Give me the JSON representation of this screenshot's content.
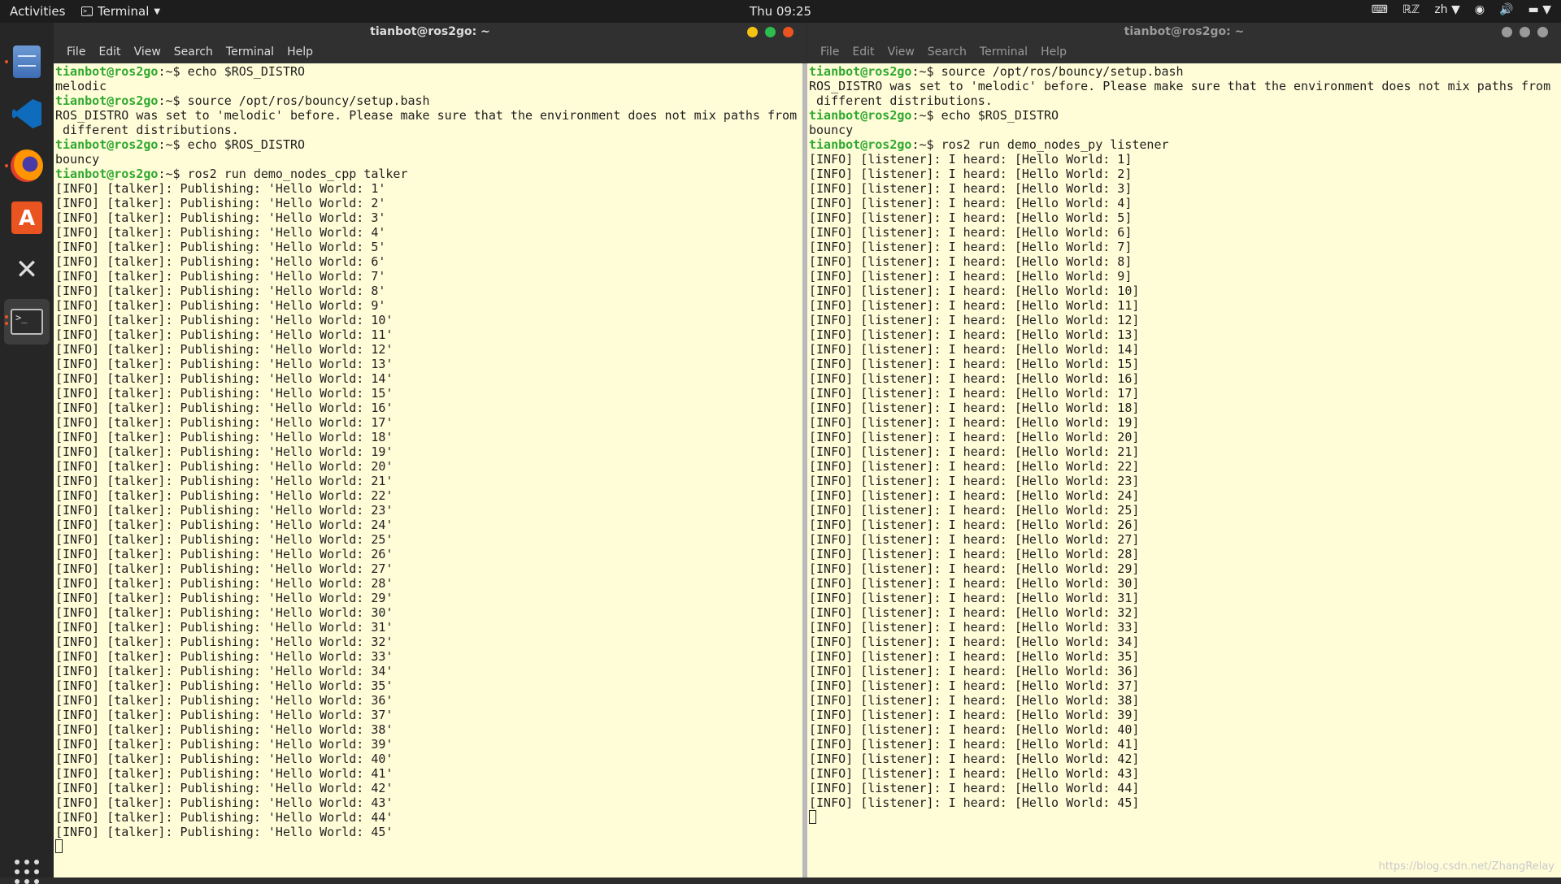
{
  "topbar": {
    "activities": "Activities",
    "app_name": "Terminal",
    "clock": "Thu 09:25",
    "tray": {
      "keyboard_layout_icon": "keyboard-icon",
      "input_method": "ℝℤ",
      "language": "zh",
      "wifi_icon": "wifi-icon",
      "volume_icon": "volume-icon",
      "battery_icon": "battery-icon"
    }
  },
  "dock": {
    "items": [
      {
        "name": "Files",
        "icon": "files-icon"
      },
      {
        "name": "Visual Studio Code",
        "icon": "vscode-icon"
      },
      {
        "name": "Firefox",
        "icon": "firefox-icon"
      },
      {
        "name": "Ubuntu Software",
        "icon": "software-icon"
      },
      {
        "name": "Tools",
        "icon": "tools-icon"
      },
      {
        "name": "Terminal",
        "icon": "terminal-icon"
      }
    ],
    "show_apps_icon": "apps-grid-icon"
  },
  "left_window": {
    "title": "tianbot@ros2go: ~",
    "menu": [
      "File",
      "Edit",
      "View",
      "Search",
      "Terminal",
      "Help"
    ],
    "prompt": "tianbot@ros2go",
    "lines": [
      {
        "type": "cmd",
        "prompt": "tianbot@ros2go",
        "suffix": ":~$ ",
        "text": "echo $ROS_DISTRO"
      },
      {
        "type": "out",
        "text": "melodic"
      },
      {
        "type": "cmd",
        "prompt": "tianbot@ros2go",
        "suffix": ":~$ ",
        "text": "source /opt/ros/bouncy/setup.bash"
      },
      {
        "type": "out",
        "text": "ROS_DISTRO was set to 'melodic' before. Please make sure that the environment does not mix paths from"
      },
      {
        "type": "out",
        "text": " different distributions."
      },
      {
        "type": "cmd",
        "prompt": "tianbot@ros2go",
        "suffix": ":~$ ",
        "text": "echo $ROS_DISTRO"
      },
      {
        "type": "out",
        "text": "bouncy"
      },
      {
        "type": "cmd",
        "prompt": "tianbot@ros2go",
        "suffix": ":~$ ",
        "text": "ros2 run demo_nodes_cpp talker"
      },
      {
        "type": "out",
        "text": "[INFO] [talker]: Publishing: 'Hello World: 1'"
      },
      {
        "type": "out",
        "text": "[INFO] [talker]: Publishing: 'Hello World: 2'"
      },
      {
        "type": "out",
        "text": "[INFO] [talker]: Publishing: 'Hello World: 3'"
      },
      {
        "type": "out",
        "text": "[INFO] [talker]: Publishing: 'Hello World: 4'"
      },
      {
        "type": "out",
        "text": "[INFO] [talker]: Publishing: 'Hello World: 5'"
      },
      {
        "type": "out",
        "text": "[INFO] [talker]: Publishing: 'Hello World: 6'"
      },
      {
        "type": "out",
        "text": "[INFO] [talker]: Publishing: 'Hello World: 7'"
      },
      {
        "type": "out",
        "text": "[INFO] [talker]: Publishing: 'Hello World: 8'"
      },
      {
        "type": "out",
        "text": "[INFO] [talker]: Publishing: 'Hello World: 9'"
      },
      {
        "type": "out",
        "text": "[INFO] [talker]: Publishing: 'Hello World: 10'"
      },
      {
        "type": "out",
        "text": "[INFO] [talker]: Publishing: 'Hello World: 11'"
      },
      {
        "type": "out",
        "text": "[INFO] [talker]: Publishing: 'Hello World: 12'"
      },
      {
        "type": "out",
        "text": "[INFO] [talker]: Publishing: 'Hello World: 13'"
      },
      {
        "type": "out",
        "text": "[INFO] [talker]: Publishing: 'Hello World: 14'"
      },
      {
        "type": "out",
        "text": "[INFO] [talker]: Publishing: 'Hello World: 15'"
      },
      {
        "type": "out",
        "text": "[INFO] [talker]: Publishing: 'Hello World: 16'"
      },
      {
        "type": "out",
        "text": "[INFO] [talker]: Publishing: 'Hello World: 17'"
      },
      {
        "type": "out",
        "text": "[INFO] [talker]: Publishing: 'Hello World: 18'"
      },
      {
        "type": "out",
        "text": "[INFO] [talker]: Publishing: 'Hello World: 19'"
      },
      {
        "type": "out",
        "text": "[INFO] [talker]: Publishing: 'Hello World: 20'"
      },
      {
        "type": "out",
        "text": "[INFO] [talker]: Publishing: 'Hello World: 21'"
      },
      {
        "type": "out",
        "text": "[INFO] [talker]: Publishing: 'Hello World: 22'"
      },
      {
        "type": "out",
        "text": "[INFO] [talker]: Publishing: 'Hello World: 23'"
      },
      {
        "type": "out",
        "text": "[INFO] [talker]: Publishing: 'Hello World: 24'"
      },
      {
        "type": "out",
        "text": "[INFO] [talker]: Publishing: 'Hello World: 25'"
      },
      {
        "type": "out",
        "text": "[INFO] [talker]: Publishing: 'Hello World: 26'"
      },
      {
        "type": "out",
        "text": "[INFO] [talker]: Publishing: 'Hello World: 27'"
      },
      {
        "type": "out",
        "text": "[INFO] [talker]: Publishing: 'Hello World: 28'"
      },
      {
        "type": "out",
        "text": "[INFO] [talker]: Publishing: 'Hello World: 29'"
      },
      {
        "type": "out",
        "text": "[INFO] [talker]: Publishing: 'Hello World: 30'"
      },
      {
        "type": "out",
        "text": "[INFO] [talker]: Publishing: 'Hello World: 31'"
      },
      {
        "type": "out",
        "text": "[INFO] [talker]: Publishing: 'Hello World: 32'"
      },
      {
        "type": "out",
        "text": "[INFO] [talker]: Publishing: 'Hello World: 33'"
      },
      {
        "type": "out",
        "text": "[INFO] [talker]: Publishing: 'Hello World: 34'"
      },
      {
        "type": "out",
        "text": "[INFO] [talker]: Publishing: 'Hello World: 35'"
      },
      {
        "type": "out",
        "text": "[INFO] [talker]: Publishing: 'Hello World: 36'"
      },
      {
        "type": "out",
        "text": "[INFO] [talker]: Publishing: 'Hello World: 37'"
      },
      {
        "type": "out",
        "text": "[INFO] [talker]: Publishing: 'Hello World: 38'"
      },
      {
        "type": "out",
        "text": "[INFO] [talker]: Publishing: 'Hello World: 39'"
      },
      {
        "type": "out",
        "text": "[INFO] [talker]: Publishing: 'Hello World: 40'"
      },
      {
        "type": "out",
        "text": "[INFO] [talker]: Publishing: 'Hello World: 41'"
      },
      {
        "type": "out",
        "text": "[INFO] [talker]: Publishing: 'Hello World: 42'"
      },
      {
        "type": "out",
        "text": "[INFO] [talker]: Publishing: 'Hello World: 43'"
      },
      {
        "type": "out",
        "text": "[INFO] [talker]: Publishing: 'Hello World: 44'"
      },
      {
        "type": "out",
        "text": "[INFO] [talker]: Publishing: 'Hello World: 45'"
      },
      {
        "type": "cursor"
      }
    ]
  },
  "right_window": {
    "title": "tianbot@ros2go: ~",
    "menu": [
      "File",
      "Edit",
      "View",
      "Search",
      "Terminal",
      "Help"
    ],
    "lines": [
      {
        "type": "cmd",
        "prompt": "tianbot@ros2go",
        "suffix": ":~$ ",
        "text": "source /opt/ros/bouncy/setup.bash"
      },
      {
        "type": "out",
        "text": "ROS_DISTRO was set to 'melodic' before. Please make sure that the environment does not mix paths from"
      },
      {
        "type": "out",
        "text": " different distributions."
      },
      {
        "type": "cmd",
        "prompt": "tianbot@ros2go",
        "suffix": ":~$ ",
        "text": "echo $ROS_DISTRO"
      },
      {
        "type": "out",
        "text": "bouncy"
      },
      {
        "type": "cmd",
        "prompt": "tianbot@ros2go",
        "suffix": ":~$ ",
        "text": "ros2 run demo_nodes_py listener"
      },
      {
        "type": "out",
        "text": "[INFO] [listener]: I heard: [Hello World: 1]"
      },
      {
        "type": "out",
        "text": "[INFO] [listener]: I heard: [Hello World: 2]"
      },
      {
        "type": "out",
        "text": "[INFO] [listener]: I heard: [Hello World: 3]"
      },
      {
        "type": "out",
        "text": "[INFO] [listener]: I heard: [Hello World: 4]"
      },
      {
        "type": "out",
        "text": "[INFO] [listener]: I heard: [Hello World: 5]"
      },
      {
        "type": "out",
        "text": "[INFO] [listener]: I heard: [Hello World: 6]"
      },
      {
        "type": "out",
        "text": "[INFO] [listener]: I heard: [Hello World: 7]"
      },
      {
        "type": "out",
        "text": "[INFO] [listener]: I heard: [Hello World: 8]"
      },
      {
        "type": "out",
        "text": "[INFO] [listener]: I heard: [Hello World: 9]"
      },
      {
        "type": "out",
        "text": "[INFO] [listener]: I heard: [Hello World: 10]"
      },
      {
        "type": "out",
        "text": "[INFO] [listener]: I heard: [Hello World: 11]"
      },
      {
        "type": "out",
        "text": "[INFO] [listener]: I heard: [Hello World: 12]"
      },
      {
        "type": "out",
        "text": "[INFO] [listener]: I heard: [Hello World: 13]"
      },
      {
        "type": "out",
        "text": "[INFO] [listener]: I heard: [Hello World: 14]"
      },
      {
        "type": "out",
        "text": "[INFO] [listener]: I heard: [Hello World: 15]"
      },
      {
        "type": "out",
        "text": "[INFO] [listener]: I heard: [Hello World: 16]"
      },
      {
        "type": "out",
        "text": "[INFO] [listener]: I heard: [Hello World: 17]"
      },
      {
        "type": "out",
        "text": "[INFO] [listener]: I heard: [Hello World: 18]"
      },
      {
        "type": "out",
        "text": "[INFO] [listener]: I heard: [Hello World: 19]"
      },
      {
        "type": "out",
        "text": "[INFO] [listener]: I heard: [Hello World: 20]"
      },
      {
        "type": "out",
        "text": "[INFO] [listener]: I heard: [Hello World: 21]"
      },
      {
        "type": "out",
        "text": "[INFO] [listener]: I heard: [Hello World: 22]"
      },
      {
        "type": "out",
        "text": "[INFO] [listener]: I heard: [Hello World: 23]"
      },
      {
        "type": "out",
        "text": "[INFO] [listener]: I heard: [Hello World: 24]"
      },
      {
        "type": "out",
        "text": "[INFO] [listener]: I heard: [Hello World: 25]"
      },
      {
        "type": "out",
        "text": "[INFO] [listener]: I heard: [Hello World: 26]"
      },
      {
        "type": "out",
        "text": "[INFO] [listener]: I heard: [Hello World: 27]"
      },
      {
        "type": "out",
        "text": "[INFO] [listener]: I heard: [Hello World: 28]"
      },
      {
        "type": "out",
        "text": "[INFO] [listener]: I heard: [Hello World: 29]"
      },
      {
        "type": "out",
        "text": "[INFO] [listener]: I heard: [Hello World: 30]"
      },
      {
        "type": "out",
        "text": "[INFO] [listener]: I heard: [Hello World: 31]"
      },
      {
        "type": "out",
        "text": "[INFO] [listener]: I heard: [Hello World: 32]"
      },
      {
        "type": "out",
        "text": "[INFO] [listener]: I heard: [Hello World: 33]"
      },
      {
        "type": "out",
        "text": "[INFO] [listener]: I heard: [Hello World: 34]"
      },
      {
        "type": "out",
        "text": "[INFO] [listener]: I heard: [Hello World: 35]"
      },
      {
        "type": "out",
        "text": "[INFO] [listener]: I heard: [Hello World: 36]"
      },
      {
        "type": "out",
        "text": "[INFO] [listener]: I heard: [Hello World: 37]"
      },
      {
        "type": "out",
        "text": "[INFO] [listener]: I heard: [Hello World: 38]"
      },
      {
        "type": "out",
        "text": "[INFO] [listener]: I heard: [Hello World: 39]"
      },
      {
        "type": "out",
        "text": "[INFO] [listener]: I heard: [Hello World: 40]"
      },
      {
        "type": "out",
        "text": "[INFO] [listener]: I heard: [Hello World: 41]"
      },
      {
        "type": "out",
        "text": "[INFO] [listener]: I heard: [Hello World: 42]"
      },
      {
        "type": "out",
        "text": "[INFO] [listener]: I heard: [Hello World: 43]"
      },
      {
        "type": "out",
        "text": "[INFO] [listener]: I heard: [Hello World: 44]"
      },
      {
        "type": "out",
        "text": "[INFO] [listener]: I heard: [Hello World: 45]"
      },
      {
        "type": "cursor"
      }
    ]
  },
  "watermark": "https://blog.csdn.net/ZhangRelay",
  "colors": {
    "terminal_bg": "#fffdd8",
    "prompt": "#2fa82f",
    "close": "#e95420",
    "minimize": "#f5c211",
    "maximize": "#2dbd4e"
  }
}
